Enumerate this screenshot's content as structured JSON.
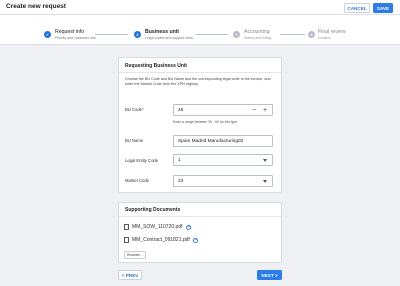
{
  "header": {
    "title": "Create new request",
    "cancel_label": "CANCEL",
    "save_label": "SAVE"
  },
  "steps": [
    {
      "number": "1",
      "title": "Request info",
      "subtitle": "Priority and customer info",
      "status": "done"
    },
    {
      "number": "2",
      "title": "Business unit",
      "subtitle": "Legal codes and support docs",
      "status": "current"
    },
    {
      "number": "3",
      "title": "Accounting",
      "subtitle": "Status and billing",
      "status": "todo"
    },
    {
      "number": "4",
      "title": "Final review",
      "subtitle": "Confirm",
      "status": "todo"
    }
  ],
  "requesting": {
    "title": "Requesting Business Unit",
    "description": "Choose the BU Code and BU Name and the corresponding legal code of the invoice, and enter the Market Code from the XPN registry.",
    "bu_code": {
      "label": "BU Code*",
      "value": "45",
      "hint": "Enter a range between 30 - 50 for this type"
    },
    "bu_name": {
      "label": "BU Name",
      "value": "Spain Madrid Manufacturing02"
    },
    "legal_entity": {
      "label": "Legal Entity Code",
      "value": "1"
    },
    "market_code": {
      "label": "Market Code",
      "value": "23"
    }
  },
  "documents": {
    "title": "Supporting Documents",
    "files": [
      "MM_SOW_110720.pdf",
      "MM_Contract_091821.pdf"
    ],
    "browse_label": "Browse..."
  },
  "footer": {
    "prev_label": "< PREV",
    "next_label": "NEXT >"
  }
}
